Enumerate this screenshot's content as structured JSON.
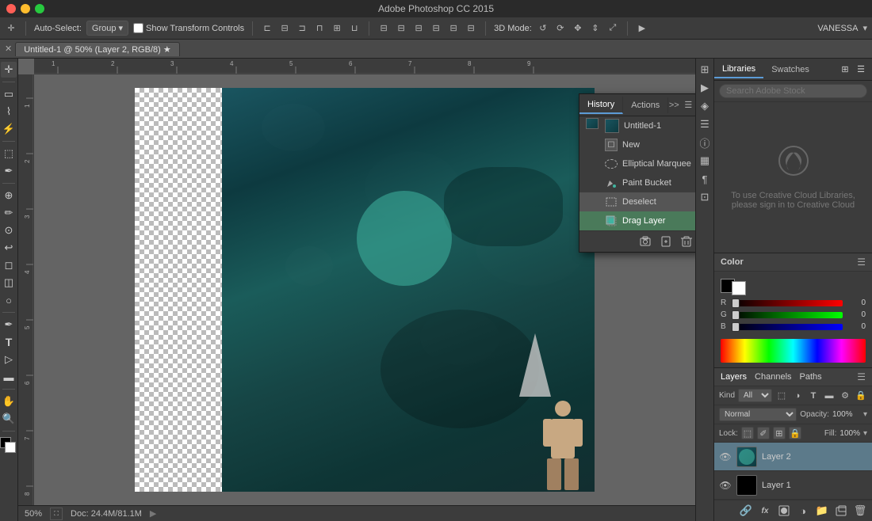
{
  "titlebar": {
    "title": "Adobe Photoshop CC 2015",
    "window_controls": [
      "close",
      "minimize",
      "maximize"
    ]
  },
  "optionsbar": {
    "auto_select_label": "Auto-Select:",
    "group_label": "Group",
    "show_transform": "Show Transform Controls",
    "mode_3d": "3D Mode:",
    "user": "VANESSA"
  },
  "doctab": {
    "label": "Untitled-1 @ 50% (Layer 2, RGB/8) ★"
  },
  "statusbar": {
    "zoom": "50%",
    "doc_size": "Doc: 24.4M/81.1M"
  },
  "history_panel": {
    "tabs": [
      {
        "label": "History",
        "active": true
      },
      {
        "label": "Actions",
        "active": false
      }
    ],
    "items": [
      {
        "label": "Untitled-1",
        "type": "source",
        "active": false
      },
      {
        "label": "New",
        "type": "new",
        "active": false
      },
      {
        "label": "Elliptical Marquee",
        "type": "marquee",
        "active": false
      },
      {
        "label": "Paint Bucket",
        "type": "paint",
        "active": false
      },
      {
        "label": "Deselect",
        "type": "deselect",
        "active": false
      },
      {
        "label": "Drag Layer",
        "type": "drag",
        "active": true
      }
    ],
    "footer_buttons": [
      "new_snapshot",
      "create_doc",
      "delete"
    ]
  },
  "right_panel": {
    "libraries_tab": "Libraries",
    "swatches_tab": "Swatches",
    "search_placeholder": "Search Adobe Stock",
    "cc_message_line1": "To use Creative Cloud Libraries,",
    "cc_message_line2": "please sign in to Creative Cloud"
  },
  "color_panel": {
    "title": "Color",
    "r_value": "0",
    "g_value": "0",
    "b_value": "0",
    "r_pct": 0,
    "g_pct": 0,
    "b_pct": 0
  },
  "layers_panel": {
    "tabs": [
      {
        "label": "Layers",
        "active": true
      },
      {
        "label": "Channels",
        "active": false
      },
      {
        "label": "Paths",
        "active": false
      }
    ],
    "kind_label": "Kind",
    "mode": "Normal",
    "opacity_label": "Opacity:",
    "opacity_value": "100%",
    "lock_label": "Lock:",
    "fill_label": "Fill:",
    "fill_value": "100%",
    "layers": [
      {
        "name": "Layer 2",
        "active": true,
        "type": "image"
      },
      {
        "name": "Layer 1",
        "active": false,
        "type": "black"
      }
    ]
  }
}
